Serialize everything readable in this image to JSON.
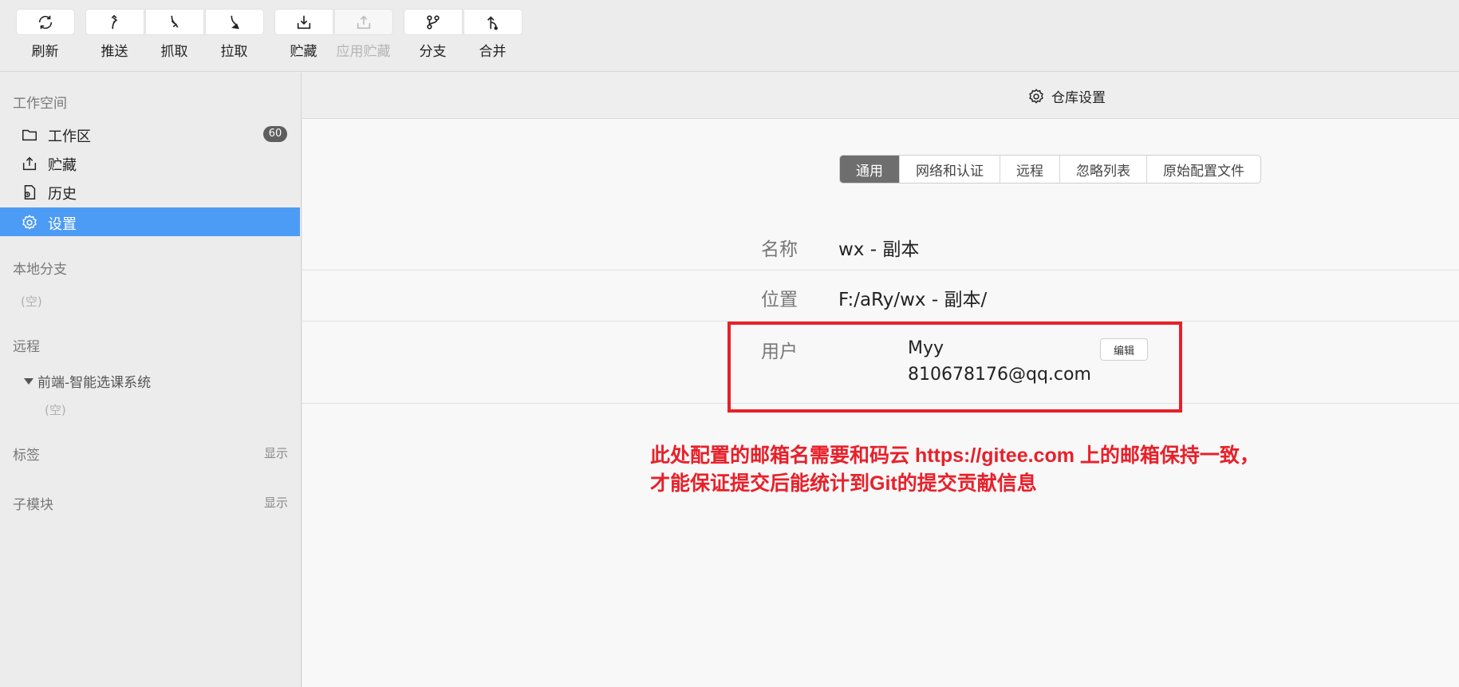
{
  "toolbar": {
    "refresh": "刷新",
    "push": "推送",
    "fetch": "抓取",
    "pull": "拉取",
    "stash": "贮藏",
    "apply_stash": "应用贮藏",
    "branch": "分支",
    "merge": "合并"
  },
  "sidebar": {
    "workspace_title": "工作空间",
    "items": [
      {
        "label": "工作区",
        "icon": "folder-icon",
        "badge": "60"
      },
      {
        "label": "贮藏",
        "icon": "stash-icon"
      },
      {
        "label": "历史",
        "icon": "history-icon"
      },
      {
        "label": "设置",
        "icon": "gear-icon",
        "active": true
      }
    ],
    "local_branches_title": "本地分支",
    "local_branches_empty": "(空)",
    "remotes_title": "远程",
    "remote_name": "前端-智能选课系统",
    "remote_empty": "(空)",
    "tags_title": "标签",
    "tags_action": "显示",
    "submodules_title": "子模块",
    "submodules_action": "显示"
  },
  "main": {
    "header_title": "仓库设置",
    "tabs": [
      "通用",
      "网络和认证",
      "远程",
      "忽略列表",
      "原始配置文件"
    ],
    "active_tab": "通用",
    "name_label": "名称",
    "name_value": "wx - 副本",
    "location_label": "位置",
    "location_value": "F:/aRy/wx - 副本/",
    "user_label": "用户",
    "user_name": "Myy",
    "user_email": "810678176@qq.com",
    "edit_button": "编辑"
  },
  "annotation": {
    "line1": "此处配置的邮箱名需要和码云 https://gitee.com 上的邮箱保持一致，",
    "line2": "才能保证提交后能统计到Git的提交贡献信息",
    "color": "#e8202a"
  },
  "colors": {
    "accent": "#4c9bf5",
    "active_tab": "#6e6e6e",
    "annotation_red": "#e8202a"
  }
}
